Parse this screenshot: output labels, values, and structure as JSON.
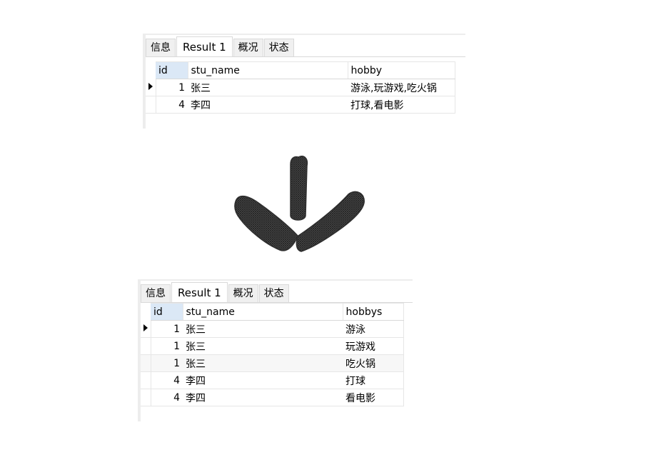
{
  "top_panel": {
    "tabs": [
      "信息",
      "Result 1",
      "概况",
      "状态"
    ],
    "active_tab": 1,
    "columns": [
      "id",
      "stu_name",
      "hobby"
    ],
    "rows": [
      {
        "id": "1",
        "stu_name": "张三",
        "hobby": "游泳,玩游戏,吃火锅",
        "selected": true
      },
      {
        "id": "4",
        "stu_name": "李四",
        "hobby": "打球,看电影",
        "selected": false
      }
    ]
  },
  "arrow": {
    "icon": "down-arrow-icon",
    "color": "#3a3a3a"
  },
  "bottom_panel": {
    "tabs": [
      "信息",
      "Result 1",
      "概况",
      "状态"
    ],
    "active_tab": 1,
    "columns": [
      "id",
      "stu_name",
      "hobbys"
    ],
    "rows": [
      {
        "id": "1",
        "stu_name": "张三",
        "hobbys": "游泳",
        "selected": true
      },
      {
        "id": "1",
        "stu_name": "张三",
        "hobbys": "玩游戏",
        "selected": false
      },
      {
        "id": "1",
        "stu_name": "张三",
        "hobbys": "吃火锅",
        "selected": false
      },
      {
        "id": "4",
        "stu_name": "李四",
        "hobbys": "打球",
        "selected": false
      },
      {
        "id": "4",
        "stu_name": "李四",
        "hobbys": "看电影",
        "selected": false
      }
    ]
  }
}
